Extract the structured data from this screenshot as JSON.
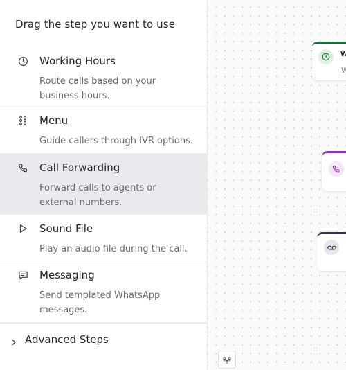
{
  "panel": {
    "title": "Drag the step you want to use",
    "steps": [
      {
        "icon": "clock-icon",
        "name": "Working Hours",
        "desc": "Route calls based on your business hours."
      },
      {
        "icon": "grid-dots-icon",
        "name": "Menu",
        "desc": "Guide callers through IVR options."
      },
      {
        "icon": "phone-icon",
        "name": "Call Forwarding",
        "desc": "Forward calls to agents or external numbers."
      },
      {
        "icon": "play-icon",
        "name": "Sound File",
        "desc": "Play an audio file during the call."
      },
      {
        "icon": "message-icon",
        "name": "Messaging",
        "desc": "Send templated WhatsApp messages."
      }
    ],
    "advanced": {
      "icon": "chevron-right-icon",
      "label": "Advanced Steps"
    }
  },
  "canvas": {
    "nodes": [
      {
        "icon": "clock-icon",
        "title": "W",
        "subtitle": "W",
        "color": "#1f6b3b"
      },
      {
        "icon": "phone-icon",
        "color": "#8a3aa8"
      },
      {
        "icon": "voicemail-icon",
        "color": "#2d3748"
      }
    ],
    "toolbar_icon": "layout-icon"
  },
  "colors": {
    "active_row": "#e9e9ee",
    "working_hours_accent": "#1f6b3b",
    "call_forwarding_accent": "#8a3aa8",
    "sound_file_accent": "#2d3748"
  }
}
